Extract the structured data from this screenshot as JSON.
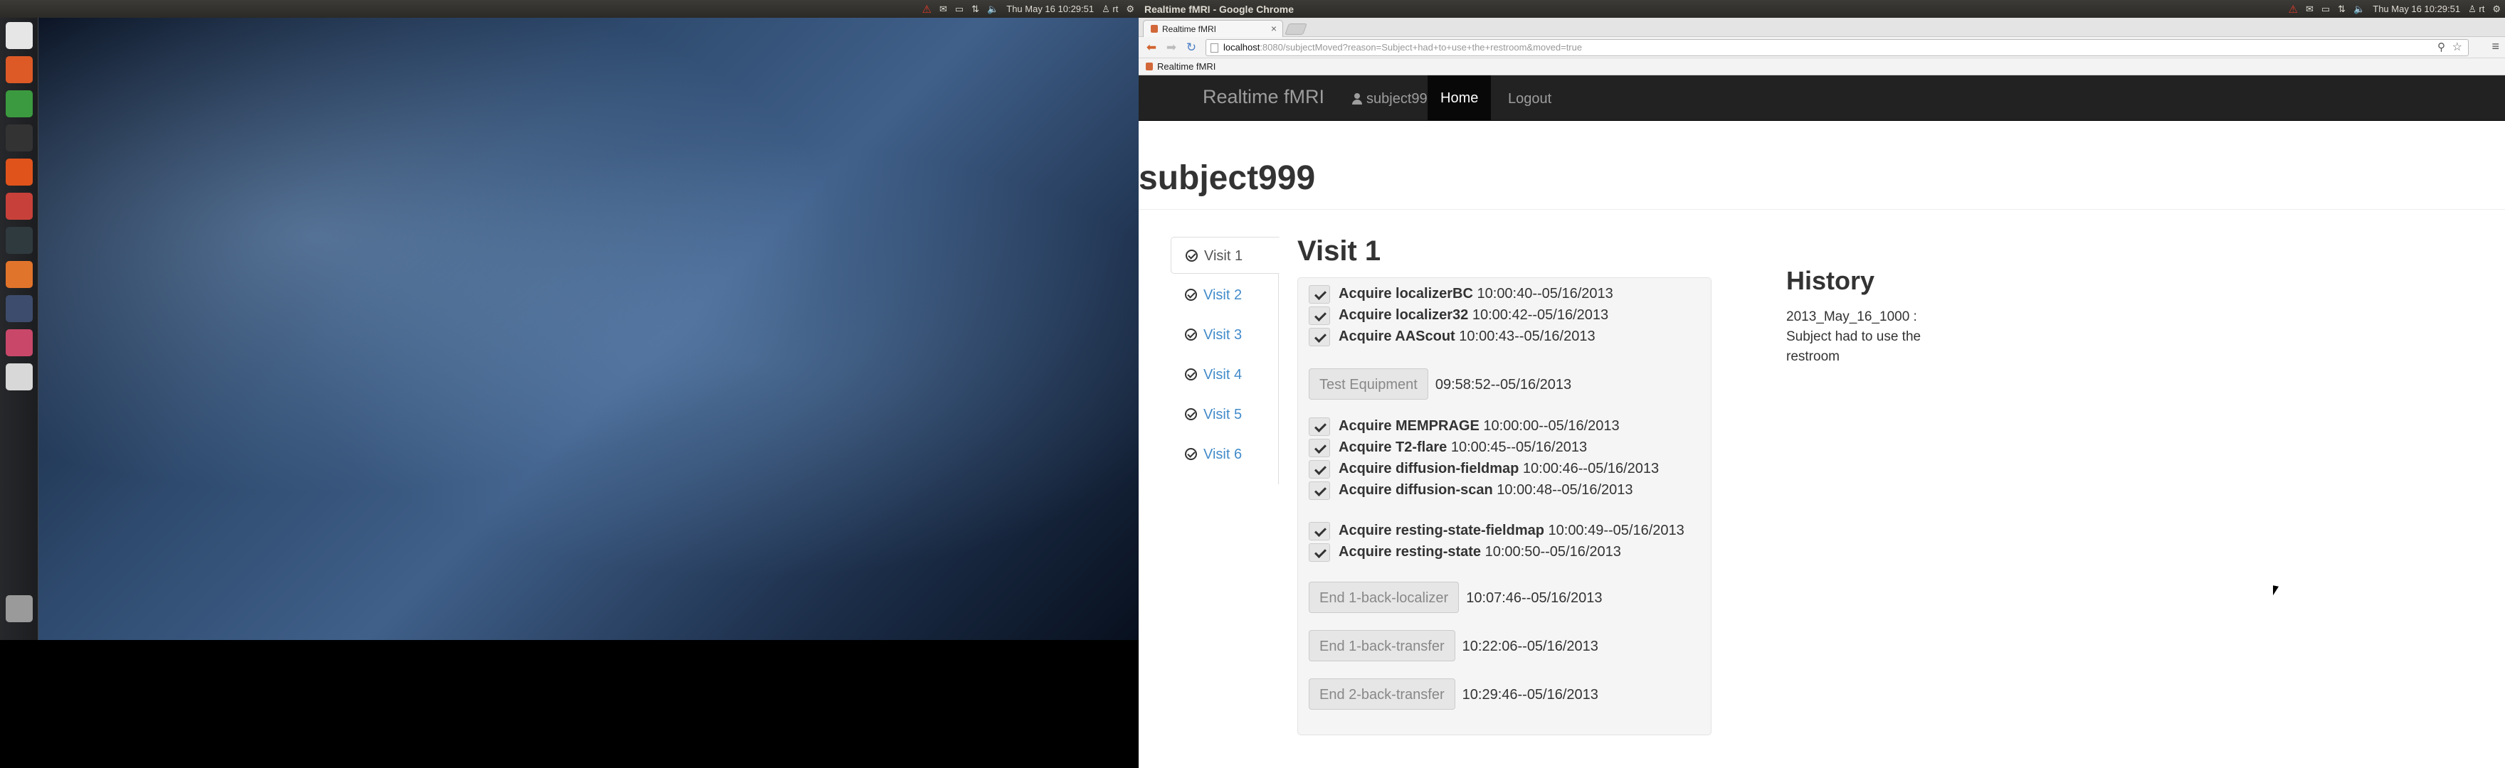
{
  "left_screen": {
    "panel": {
      "datetime": "Thu May 16 10:29:51",
      "user": "rt"
    },
    "launcher_items": [
      {
        "name": "dash-icon",
        "color": "#e6e6e6"
      },
      {
        "name": "files-icon",
        "color": "#dd5a26"
      },
      {
        "name": "chrome-icon",
        "color": "#3b9a3f"
      },
      {
        "name": "terminal-icon",
        "color": "#333333"
      },
      {
        "name": "software-center-icon",
        "color": "#e0541c"
      },
      {
        "name": "settings-icon",
        "color": "#c7413a"
      },
      {
        "name": "system-monitor-icon",
        "color": "#2f3a3f"
      },
      {
        "name": "home-folder-icon",
        "color": "#e1742b"
      },
      {
        "name": "remote-desktop-icon",
        "color": "#3d4c6c"
      },
      {
        "name": "image-viewer-icon",
        "color": "#c9486a"
      },
      {
        "name": "disc-icon",
        "color": "#d8d8d8"
      }
    ]
  },
  "right_screen": {
    "panel": {
      "window_title": "Realtime fMRI - Google Chrome",
      "datetime": "Thu May 16 10:29:51",
      "user": "rt"
    },
    "browser": {
      "tab_title": "Realtime fMRI",
      "url_host": "localhost",
      "url_rest": ":8080/subjectMoved?reason=Subject+had+to+use+the+restroom&moved=true",
      "bookmark": "Realtime fMRI"
    },
    "page": {
      "navbar": {
        "brand": "Realtime fMRI",
        "user": "subject999",
        "home": "Home",
        "logout": "Logout"
      },
      "title": "subject999",
      "visits": [
        "Visit 1",
        "Visit 2",
        "Visit 3",
        "Visit 4",
        "Visit 5",
        "Visit 6"
      ],
      "visit_heading": "Visit 1",
      "steps": [
        {
          "kind": "check",
          "name": "Acquire localizerBC",
          "time": "10:00:40--05/16/2013"
        },
        {
          "kind": "check",
          "name": "Acquire localizer32",
          "time": "10:00:42--05/16/2013"
        },
        {
          "kind": "check",
          "name": "Acquire AAScout",
          "time": "10:00:43--05/16/2013"
        },
        {
          "kind": "button",
          "name": "Test Equipment",
          "time": "09:58:52--05/16/2013"
        },
        {
          "kind": "check",
          "name": "Acquire MEMPRAGE",
          "time": "10:00:00--05/16/2013"
        },
        {
          "kind": "check",
          "name": "Acquire T2-flare",
          "time": "10:00:45--05/16/2013"
        },
        {
          "kind": "check",
          "name": "Acquire diffusion-fieldmap",
          "time": "10:00:46--05/16/2013"
        },
        {
          "kind": "check",
          "name": "Acquire diffusion-scan",
          "time": "10:00:48--05/16/2013"
        },
        {
          "kind": "check",
          "name": "Acquire resting-state-fieldmap",
          "time": "10:00:49--05/16/2013"
        },
        {
          "kind": "check",
          "name": "Acquire resting-state",
          "time": "10:00:50--05/16/2013"
        },
        {
          "kind": "button",
          "name": "End 1-back-localizer",
          "time": "10:07:46--05/16/2013"
        },
        {
          "kind": "button",
          "name": "End 1-back-transfer",
          "time": "10:22:06--05/16/2013"
        },
        {
          "kind": "button",
          "name": "End 2-back-transfer",
          "time": "10:29:46--05/16/2013"
        }
      ],
      "history": {
        "title": "History",
        "entries": [
          "2013_May_16_1000 : Subject had to use the restroom"
        ]
      }
    }
  }
}
